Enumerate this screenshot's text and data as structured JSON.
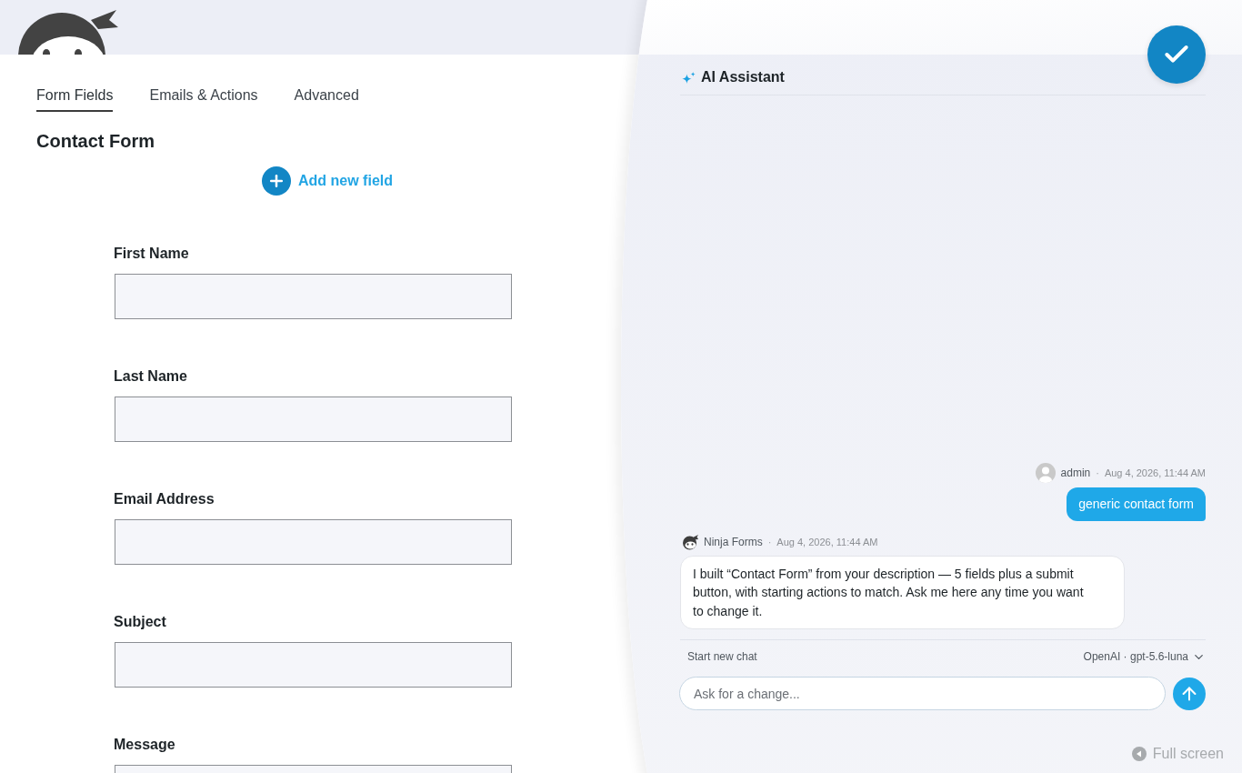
{
  "header": {
    "tabs": [
      {
        "label": "Form Fields",
        "selected": true
      },
      {
        "label": "Emails & Actions",
        "selected": false
      },
      {
        "label": "Advanced",
        "selected": false
      }
    ]
  },
  "form": {
    "title": "Contact Form",
    "add_field": "Add new field",
    "fields": [
      {
        "label": "First Name"
      },
      {
        "label": "Last Name"
      },
      {
        "label": "Email Address"
      },
      {
        "label": "Subject"
      },
      {
        "label": "Message"
      }
    ]
  },
  "assistant": {
    "title": "AI Assistant",
    "messages": [
      {
        "kind": "user",
        "author": "admin",
        "separator": "·",
        "time": "Aug 4, 2026, 11:44 AM",
        "text": "generic contact form"
      },
      {
        "kind": "assistant",
        "author": "Ninja Forms",
        "separator": "·",
        "time": "Aug 4, 2026, 11:44 AM",
        "text": "I built “Contact Form” from your description — 5 fields plus a submit button, with starting actions to match. Ask me here any time you want to change it."
      }
    ],
    "new_chat": "Start new chat",
    "model": "OpenAI · gpt-5.6-luna",
    "input": {
      "placeholder": "Ask for a change..."
    }
  },
  "full_screen": "Full screen"
}
